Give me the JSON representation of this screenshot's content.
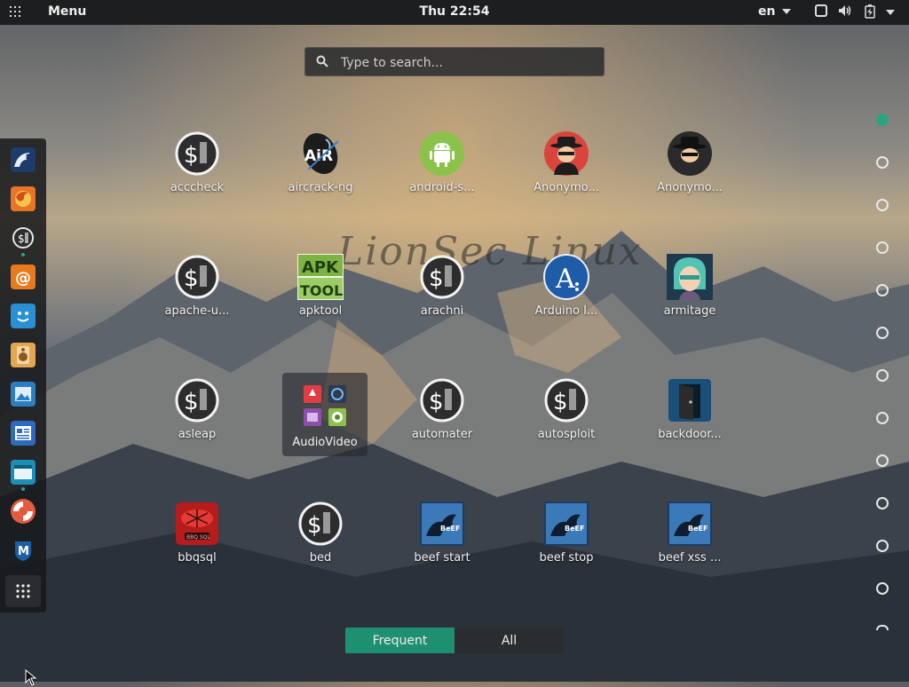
{
  "topbar": {
    "menu_label": "Menu",
    "clock": "Thu 22:54",
    "language": "en",
    "icons": [
      "apps-grid-icon",
      "screen-icon",
      "volume-icon",
      "battery-icon",
      "power-menu-icon"
    ]
  },
  "search": {
    "placeholder": "Type to search..."
  },
  "watermark": "LionSec Linux",
  "dock": {
    "items": [
      {
        "name": "dock-kali-dragon",
        "icon": "dragon-icon"
      },
      {
        "name": "dock-firefox",
        "icon": "firefox-icon"
      },
      {
        "name": "dock-dollar-app",
        "icon": "dollar-terminal-icon"
      },
      {
        "name": "dock-email",
        "icon": "at-sign-icon"
      },
      {
        "name": "dock-smiley",
        "icon": "smiley-icon"
      },
      {
        "name": "dock-speaker",
        "icon": "speaker-icon"
      },
      {
        "name": "dock-image-viewer",
        "icon": "image-icon"
      },
      {
        "name": "dock-document",
        "icon": "document-icon"
      },
      {
        "name": "dock-window",
        "icon": "window-icon"
      },
      {
        "name": "dock-help",
        "icon": "lifebuoy-icon"
      },
      {
        "name": "dock-metasploit",
        "icon": "metasploit-icon"
      }
    ],
    "show_apps": "show-apps-icon"
  },
  "apps": [
    {
      "label": "acccheck",
      "icon": "dollar-terminal-icon"
    },
    {
      "label": "aircrack-ng",
      "icon": "aircrack-icon"
    },
    {
      "label": "android-s...",
      "icon": "android-icon"
    },
    {
      "label": "Anonymo...",
      "icon": "anonymous-red-icon"
    },
    {
      "label": "Anonymo...",
      "icon": "anonymous-dark-icon"
    },
    {
      "label": "apache-u...",
      "icon": "dollar-terminal-icon"
    },
    {
      "label": "apktool",
      "icon": "apktool-icon"
    },
    {
      "label": "arachni",
      "icon": "dollar-terminal-icon"
    },
    {
      "label": "Arduino I...",
      "icon": "arduino-icon"
    },
    {
      "label": "armitage",
      "icon": "armitage-icon"
    },
    {
      "label": "asleap",
      "icon": "dollar-terminal-icon"
    },
    {
      "label": "AudioVideo",
      "icon": "folder-icon"
    },
    {
      "label": "automater",
      "icon": "dollar-terminal-icon"
    },
    {
      "label": "autosploit",
      "icon": "dollar-terminal-icon"
    },
    {
      "label": "backdoor...",
      "icon": "backdoor-icon"
    },
    {
      "label": "bbqsql",
      "icon": "bbqsql-icon"
    },
    {
      "label": "bed",
      "icon": "dollar-terminal-icon"
    },
    {
      "label": "beef start",
      "icon": "beef-icon"
    },
    {
      "label": "beef stop",
      "icon": "beef-icon"
    },
    {
      "label": "beef xss ...",
      "icon": "beef-icon"
    }
  ],
  "pages": {
    "count": 13,
    "current": 1
  },
  "tabs": [
    {
      "label": "Frequent",
      "active": true
    },
    {
      "label": "All",
      "active": false
    }
  ],
  "colors": {
    "accent": "#2aa37f",
    "topbar": "#1c1e20"
  }
}
